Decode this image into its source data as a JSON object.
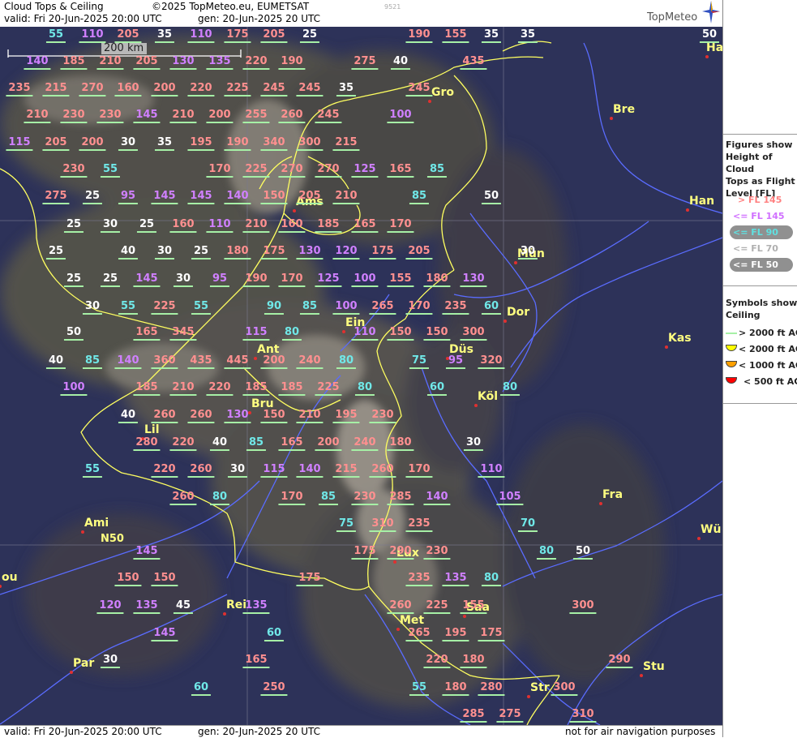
{
  "header": {
    "title": "Cloud Tops & Ceiling",
    "copyright": "©2025 TopMeteo.eu, EUMETSAT",
    "valid": "valid:  Fri  20-Jun-2025  20:00 UTC",
    "gen": "gen: 20-Jun-2025 20 UTC",
    "image_id": "9521",
    "brand": "TopMeteo"
  },
  "footer": {
    "valid": "valid:  Fri  20-Jun-2025  20:00 UTC",
    "gen": "gen: 20-Jun-2025 20 UTC",
    "disclaimer": "not for air navigation purposes"
  },
  "scale_bar": {
    "label": "200 km"
  },
  "latitude_label": "N50",
  "legend": {
    "tops_title": [
      "Figures show",
      "Height of Cloud",
      "Tops as Flight",
      "Level  [FL]"
    ],
    "tops": [
      {
        "label": "> FL 145",
        "color": "#ff8080",
        "bg": ""
      },
      {
        "label": "<= FL 145",
        "color": "#d070ff",
        "bg": ""
      },
      {
        "label": "<= FL 90",
        "color": "#60e0e0",
        "bg": "#909090"
      },
      {
        "label": "<= FL 70",
        "color": "#b0b0b0",
        "bg": ""
      },
      {
        "label": "<= FL 50",
        "color": "#ffffff",
        "bg": "#909090"
      }
    ],
    "ceiling_title": [
      "Symbols show",
      "Ceiling"
    ],
    "ceiling": [
      {
        "label": "> 2000 ft AGL",
        "color": "#a6f0a6"
      },
      {
        "label": "< 2000 ft AGL",
        "color": "#ffff00"
      },
      {
        "label": "< 1000 ft AGL",
        "color": "#ffa000"
      },
      {
        "label": "< 500 ft AGL",
        "color": "#ff0000"
      }
    ]
  },
  "colors": {
    "high": "#ff9090",
    "mid": "#d080ff",
    "low90": "#70e8e8",
    "low50": "#ffffff",
    "city": "#ffff80",
    "coast": "#ffff60",
    "river": "#5a6cff"
  },
  "cities": [
    "Ha",
    "Bre",
    "Gro",
    "Ams",
    "Han",
    "Mün",
    "Dor",
    "Ein",
    "Kas",
    "Ant",
    "Düs",
    "Köl",
    "Bru",
    "Lil",
    "Fra",
    "Ami",
    "Wü",
    "Lux",
    "ou",
    "Rei",
    "Saa",
    "Met",
    "Stu",
    "Par",
    "Str"
  ],
  "values": [
    "55",
    "110",
    "205",
    "35",
    "110",
    "175",
    "205",
    "25",
    "190",
    "155",
    "35",
    "35",
    "50",
    "140",
    "185",
    "210",
    "205",
    "130",
    "135",
    "220",
    "190",
    "275",
    "40",
    "435",
    "235",
    "215",
    "270",
    "160",
    "200",
    "220",
    "225",
    "245",
    "245",
    "35",
    "245",
    "210",
    "230",
    "230",
    "145",
    "210",
    "200",
    "255",
    "260",
    "245",
    "100",
    "115",
    "205",
    "200",
    "30",
    "35",
    "195",
    "190",
    "340",
    "300",
    "215",
    "230",
    "55",
    "170",
    "225",
    "270",
    "270",
    "125",
    "165",
    "85",
    "275",
    "25",
    "95",
    "145",
    "145",
    "140",
    "150",
    "205",
    "210",
    "85",
    "50",
    "25",
    "30",
    "25",
    "160",
    "110",
    "210",
    "160",
    "185",
    "165",
    "170",
    "25",
    "40",
    "30",
    "25",
    "180",
    "175",
    "130",
    "120",
    "175",
    "205",
    "30",
    "25",
    "25",
    "145",
    "30",
    "95",
    "190",
    "170",
    "125",
    "100",
    "155",
    "180",
    "130",
    "30",
    "55",
    "225",
    "55",
    "90",
    "85",
    "100",
    "265",
    "170",
    "235",
    "60",
    "50",
    "165",
    "345",
    "115",
    "80",
    "110",
    "150",
    "150",
    "300",
    "40",
    "85",
    "140",
    "360",
    "435",
    "445",
    "200",
    "240",
    "80",
    "75",
    "95",
    "320",
    "100",
    "185",
    "210",
    "220",
    "185",
    "185",
    "225",
    "80",
    "60",
    "80",
    "40",
    "260",
    "260",
    "130",
    "150",
    "210",
    "195",
    "230",
    "280",
    "220",
    "40",
    "85",
    "165",
    "200",
    "240",
    "180",
    "30",
    "55",
    "220",
    "260",
    "30",
    "115",
    "140",
    "215",
    "260",
    "170",
    "110",
    "260",
    "80",
    "170",
    "85",
    "230",
    "285",
    "140",
    "105",
    "75",
    "310",
    "235",
    "70",
    "145",
    "175",
    "290",
    "230",
    "80",
    "50",
    "150",
    "150",
    "175",
    "235",
    "135",
    "80",
    "120",
    "135",
    "45",
    "135",
    "260",
    "225",
    "155",
    "300",
    "145",
    "60",
    "265",
    "195",
    "175",
    "30",
    "165",
    "220",
    "180",
    "290",
    "60",
    "250",
    "55",
    "180",
    "280",
    "300",
    "285",
    "275",
    "310"
  ]
}
